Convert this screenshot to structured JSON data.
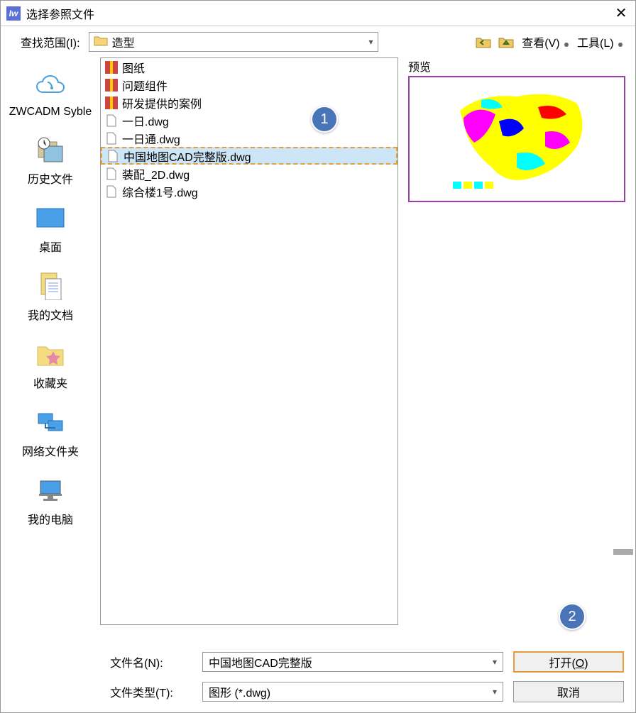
{
  "dialog": {
    "title": "选择参照文件"
  },
  "toolbar": {
    "lookin_label": "查找范围(I):",
    "folder_name": "造型",
    "view_label": "查看(V)",
    "tools_label": "工具(L)"
  },
  "sidebar": {
    "items": [
      {
        "label": "ZWCADM Syble"
      },
      {
        "label": "历史文件"
      },
      {
        "label": "桌面"
      },
      {
        "label": "我的文档"
      },
      {
        "label": "收藏夹"
      },
      {
        "label": "网络文件夹"
      },
      {
        "label": "我的电脑"
      }
    ]
  },
  "filelist": {
    "items": [
      {
        "name": "图纸",
        "type": "archive"
      },
      {
        "name": "问题组件",
        "type": "archive"
      },
      {
        "name": "研发提供的案例",
        "type": "archive"
      },
      {
        "name": "一日.dwg",
        "type": "file"
      },
      {
        "name": "一日通.dwg",
        "type": "file"
      },
      {
        "name": "中国地图CAD完整版.dwg",
        "type": "file",
        "selected": true
      },
      {
        "name": "装配_2D.dwg",
        "type": "file"
      },
      {
        "name": "综合楼1号.dwg",
        "type": "file"
      }
    ]
  },
  "preview": {
    "label": "预览"
  },
  "bottom": {
    "filename_label": "文件名(N):",
    "filename_value": "中国地图CAD完整版",
    "filetype_label": "文件类型(T):",
    "filetype_value": "图形 (*.dwg)",
    "open_label": "打开(O)",
    "cancel_label": "取消"
  },
  "badges": {
    "one": "1",
    "two": "2"
  }
}
